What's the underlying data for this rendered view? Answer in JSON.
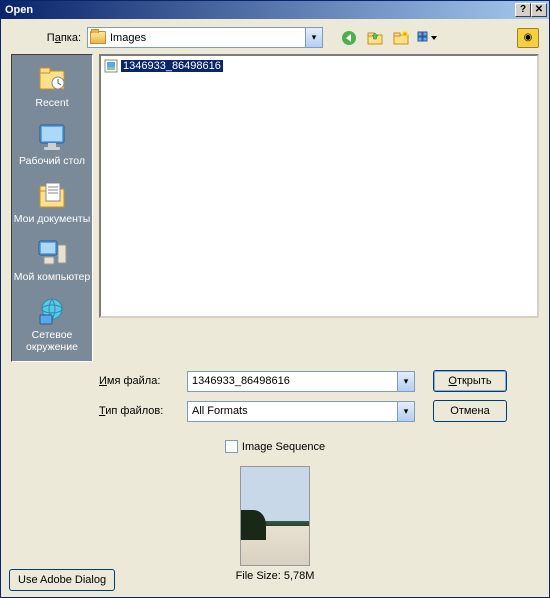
{
  "title": "Open",
  "folder_label_pre": "П",
  "folder_label_u": "а",
  "folder_label_post": "пка:",
  "folder_value": "Images",
  "places": [
    {
      "label": "Recent"
    },
    {
      "label": "Рабочий стол"
    },
    {
      "label": "Мои документы"
    },
    {
      "label": "Мой компьютер"
    },
    {
      "label": "Сетевое окружение"
    }
  ],
  "file": {
    "name": "1346933_86498616"
  },
  "filename_label_u": "И",
  "filename_label_post": "мя файла:",
  "filename_value": "1346933_86498616",
  "filetype_label_u": "Т",
  "filetype_label_post": "ип файлов:",
  "filetype_value": "All Formats",
  "open_btn_u": "О",
  "open_btn_post": "ткрыть",
  "cancel_btn": "Отмена",
  "seq_label": "Image Sequence",
  "filesize": "File Size: 5,78М",
  "adobe_dialog": "Use Adobe Dialog"
}
